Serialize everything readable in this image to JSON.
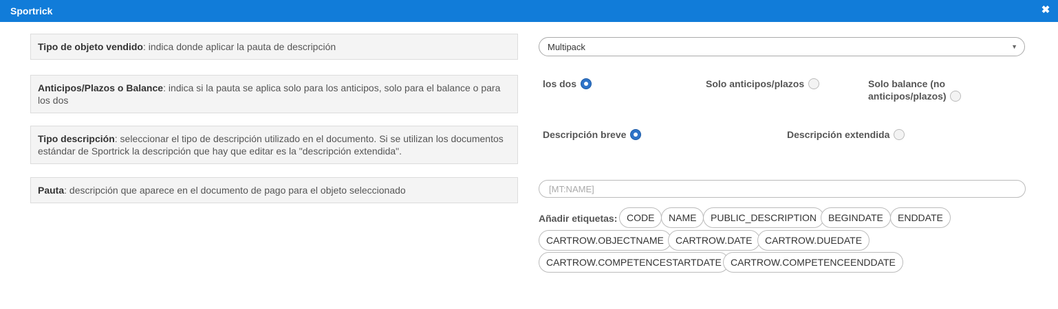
{
  "window": {
    "title": "Sportrick",
    "close_icon": "close-icon"
  },
  "rows": {
    "tipo_objeto": {
      "label": "Tipo de objeto vendido",
      "text": ": indica donde aplicar la pauta de descripción"
    },
    "anticipos": {
      "label": "Anticipos/Plazos o Balance",
      "text": ": indica si la pauta se aplica solo para los anticipos, solo para el balance o para los dos"
    },
    "tipo_desc": {
      "label": "Tipo descripción",
      "text": ": seleccionar el tipo de descripción utilizado en el documento. Si se utilizan los documentos estándar de Sportrick la descripción que hay que editar es la \"descripción extendida\"."
    },
    "pauta": {
      "label": "Pauta",
      "text": ": descripción que aparece en el documento de pago para el objeto seleccionado"
    }
  },
  "select": {
    "value": "Multipack"
  },
  "radios_apply": {
    "options": [
      {
        "label": "los dos",
        "checked": true
      },
      {
        "label": "Solo anticipos/plazos",
        "checked": false
      },
      {
        "label": "Solo balance (no anticipos/plazos)",
        "checked": false
      }
    ]
  },
  "radios_desc": {
    "options": [
      {
        "label": "Descripción breve",
        "checked": true
      },
      {
        "label": "Descripción extendida",
        "checked": false
      }
    ]
  },
  "pattern_input": {
    "value": "[MT:NAME]"
  },
  "tags": {
    "label": "Añadir etiquetas:",
    "items": [
      "CODE",
      "NAME",
      "PUBLIC_DESCRIPTION",
      "BEGINDATE",
      "ENDDATE",
      "CARTROW.OBJECTNAME",
      "CARTROW.DATE",
      "CARTROW.DUEDATE",
      "CARTROW.COMPETENCESTARTDATE",
      "CARTROW.COMPETENCEENDDATE"
    ]
  }
}
